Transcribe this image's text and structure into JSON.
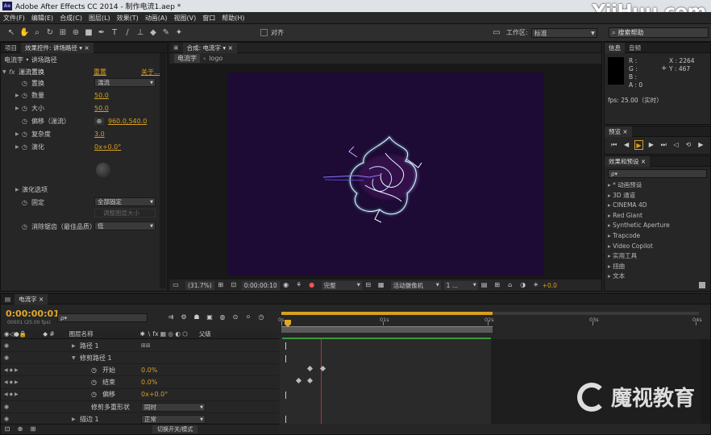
{
  "titlebar": {
    "app_icon": "Ae",
    "title": "Adobe After Effects CC 2014 - 制作电流1.aep *"
  },
  "menu": [
    "文件(F)",
    "编辑(E)",
    "合成(C)",
    "图层(L)",
    "效果(T)",
    "动画(A)",
    "视图(V)",
    "窗口",
    "帮助(H)"
  ],
  "toolbar": {
    "align_label": "对齐",
    "workspace_label": "工作区:",
    "workspace_value": "标准",
    "search_placeholder": "搜索帮助"
  },
  "project_tabs": {
    "project": "项目",
    "effect_controls": "效果控件: 讲场路径"
  },
  "effect_controls": {
    "header": "电流字 • 讲场路径",
    "effect_name": "湍流置换",
    "reset": "重置",
    "about": "关于...",
    "props": [
      {
        "label": "置换",
        "value": "湍流"
      },
      {
        "label": "数量",
        "value": "50.0"
      },
      {
        "label": "大小",
        "value": "50.0"
      },
      {
        "label": "偏移（湍流）",
        "value": "960.0,540.0"
      },
      {
        "label": "复杂度",
        "value": "3.0"
      },
      {
        "label": "演化",
        "value": "0x+0.0°"
      }
    ],
    "evolution_options": "演化选项",
    "fixed_label": "固定",
    "fixed_value": "全部固定",
    "resize_label": "调整图层大小",
    "antialias_label": "消除锯齿（最佳品质）",
    "antialias_value": "低"
  },
  "comp": {
    "tab": "合成: 电流字",
    "breadcrumb": [
      "电流字",
      "logo"
    ],
    "zoom": "(31.7%)",
    "timecode": "0:00:00:10",
    "quality": "完整",
    "camera": "活动摄像机",
    "views": "1 ...",
    "exposure": "+0.0"
  },
  "info": {
    "tabs": [
      "信息",
      "音频"
    ],
    "r": "R :",
    "g": "G :",
    "b": "B :",
    "a": "A : 0",
    "x": "X : 2264",
    "y": "Y : 467",
    "fps": "fps: 25.00（实时）"
  },
  "preview_tab": "预览",
  "effects_presets": {
    "tab": "效果和预设",
    "search_placeholder": "ρ▾",
    "items": [
      "* 动画预设",
      "3D 通道",
      "CINEMA 4D",
      "Red Giant",
      "Synthetic Aperture",
      "Trapcode",
      "Video Copilot",
      "实用工具",
      "扭曲",
      "文本"
    ]
  },
  "timeline": {
    "tab": "电流字",
    "timecode": "0:00:00:01",
    "frame_info": "00001 (25.00 fps)",
    "search_placeholder": "ρ▾",
    "col_layer_name": "图层名称",
    "col_parent": "父级",
    "ruler": [
      "0s",
      "01s",
      "02s",
      "03s",
      "04s"
    ],
    "rows": [
      {
        "name": "路径 1"
      },
      {
        "name": "修剪路径 1"
      },
      {
        "name": "开始",
        "value": "0.0%"
      },
      {
        "name": "结束",
        "value": "0.0%"
      },
      {
        "name": "偏移",
        "value": "0x+0.0°"
      },
      {
        "name": "修剪多重形状",
        "value": "同时"
      },
      {
        "name": "描边 1",
        "value": "正常"
      }
    ],
    "footer_label": "切换开关/模式"
  },
  "watermark": {
    "top": "YiiHuu.com",
    "bottom": "魔视教育"
  }
}
